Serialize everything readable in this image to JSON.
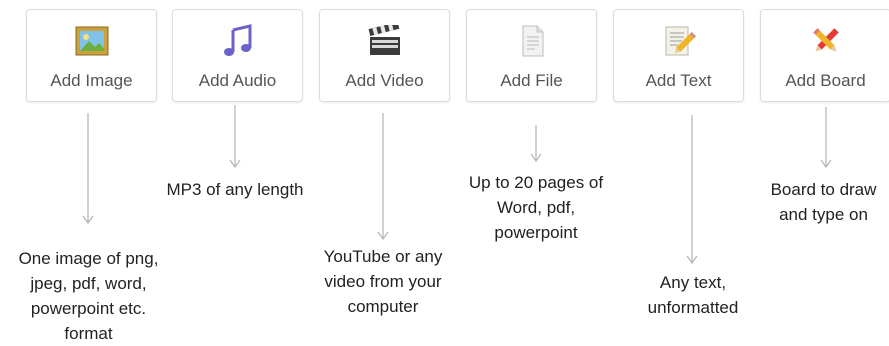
{
  "buttons": [
    {
      "label": "Add Image",
      "icon": "image-icon",
      "description": [
        "One image of png,",
        "jpeg, pdf, word,",
        "powerpoint etc.",
        "format"
      ]
    },
    {
      "label": "Add Audio",
      "icon": "music-note-icon",
      "description": [
        "MP3 of any length"
      ]
    },
    {
      "label": "Add Video",
      "icon": "clapperboard-icon",
      "description": [
        "YouTube or any",
        "video from your",
        "computer"
      ]
    },
    {
      "label": "Add File",
      "icon": "document-icon",
      "description": [
        "Up to 20 pages of",
        "Word, pdf,",
        "powerpoint"
      ]
    },
    {
      "label": "Add Text",
      "icon": "pencil-paper-icon",
      "description": [
        "Any text,",
        "unformatted"
      ]
    },
    {
      "label": "Add Board",
      "icon": "pencil-crossed-icon",
      "description": [
        "Board to draw",
        "and type on"
      ]
    }
  ],
  "colors": {
    "button_border": "#dcdcdc",
    "label_text": "#555555",
    "arrow": "#b8b8b8",
    "description_text": "#222222"
  }
}
